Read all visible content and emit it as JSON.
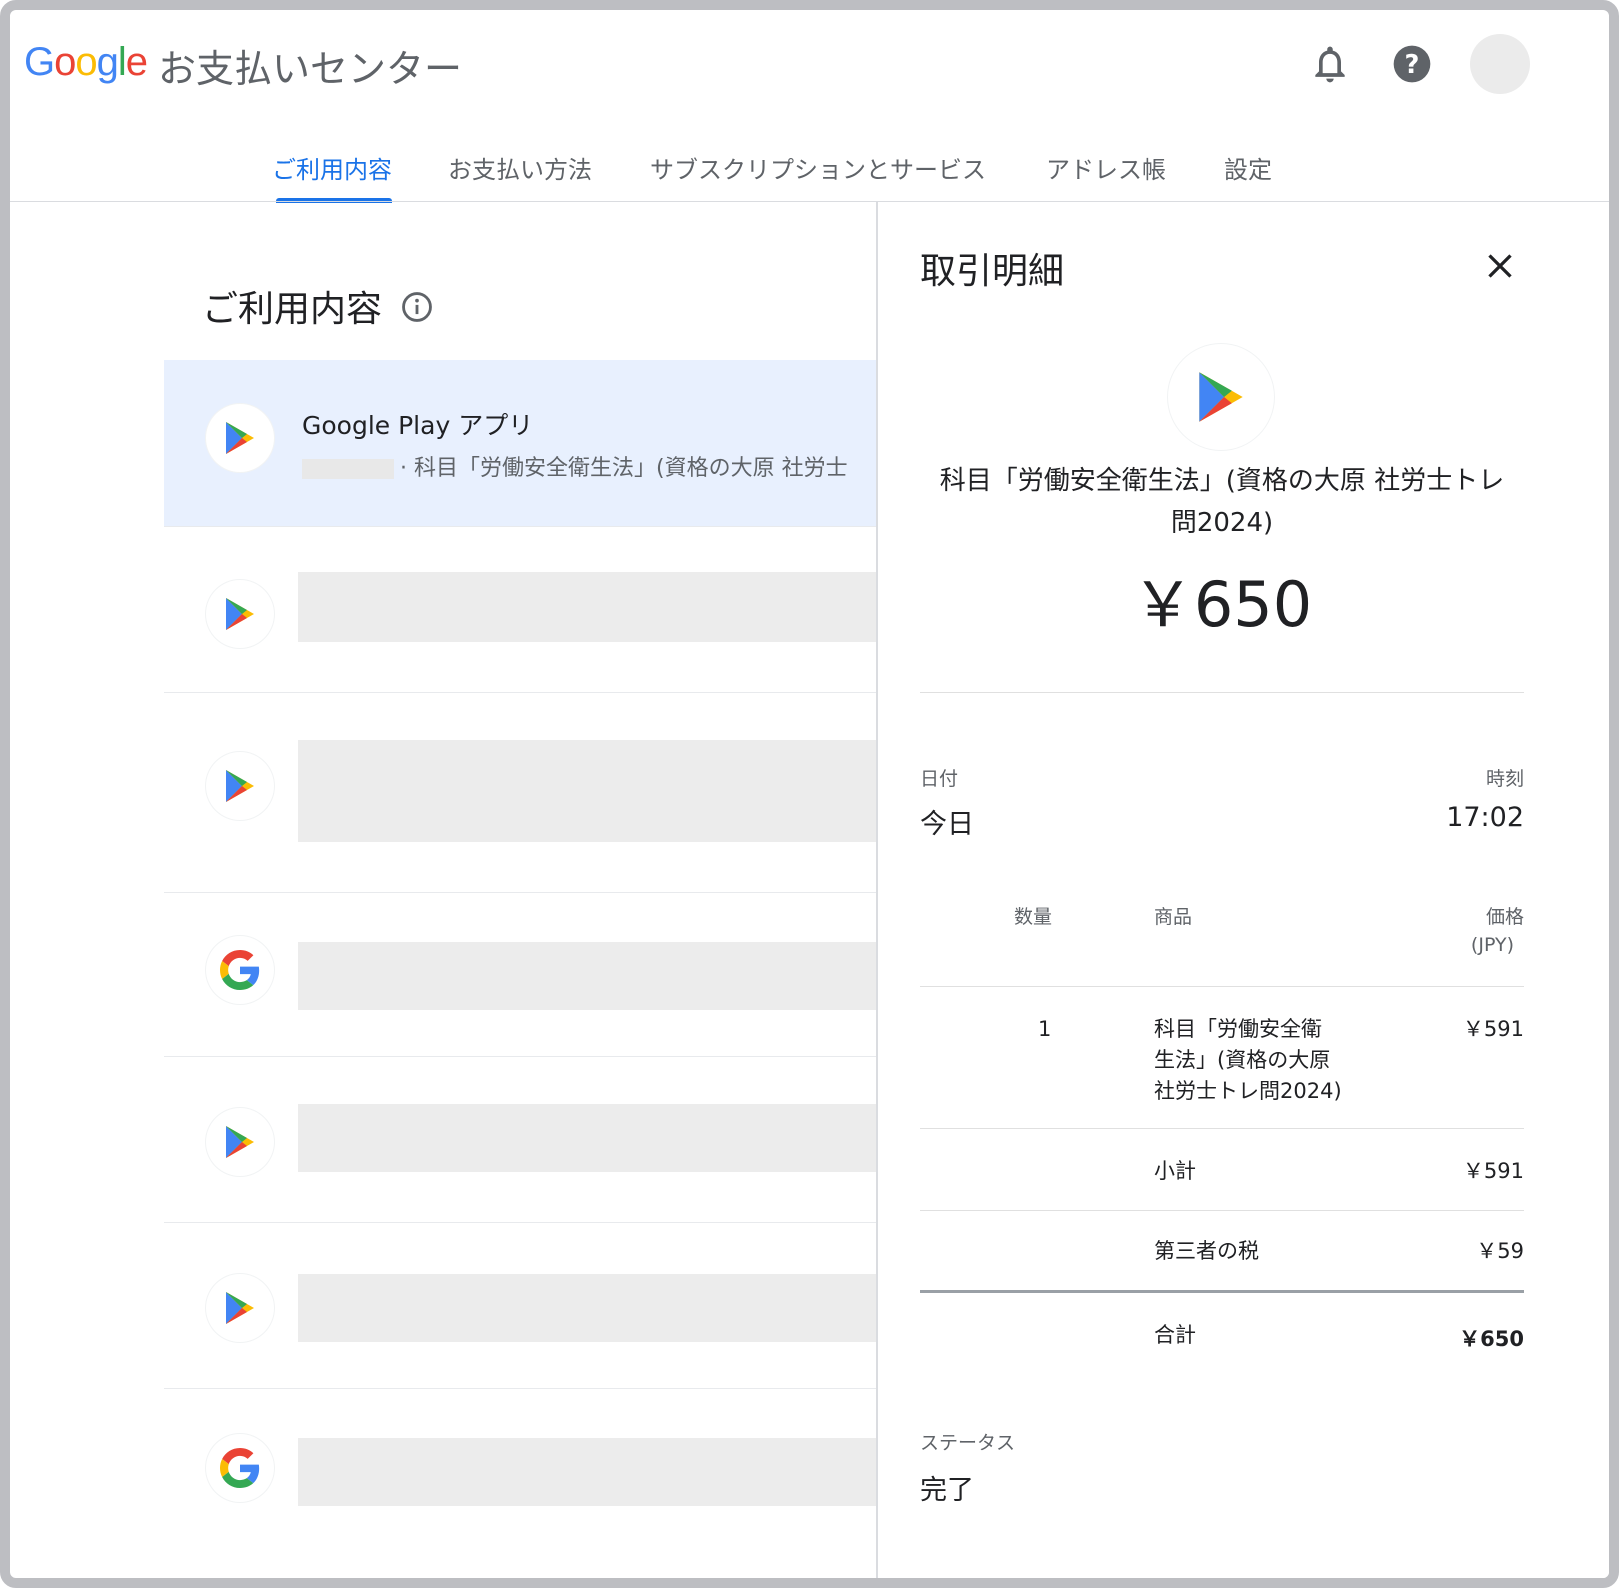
{
  "header": {
    "logo_letters": [
      "G",
      "o",
      "o",
      "g",
      "l",
      "e"
    ],
    "logo_colors": [
      "#4285F4",
      "#EA4335",
      "#FBBC05",
      "#4285F4",
      "#34A853",
      "#EA4335"
    ],
    "app_title": "お支払いセンター",
    "icons": [
      "notifications-bell-icon",
      "help-icon"
    ]
  },
  "tabs": [
    {
      "label": "ご利用内容",
      "active": true
    },
    {
      "label": "お支払い方法",
      "active": false
    },
    {
      "label": "サブスクリプションとサービス",
      "active": false
    },
    {
      "label": "アドレス帳",
      "active": false
    },
    {
      "label": "設定",
      "active": false
    }
  ],
  "activity": {
    "title": "ご利用内容",
    "info_icon": "info-icon",
    "rows": [
      {
        "icon": "google-play-icon",
        "title": "Google Play アプリ",
        "subtitle": "· 科目「労働安全衛生法」(資格の大原 社労士",
        "selected": true
      },
      {
        "icon": "google-play-icon",
        "title": "",
        "subtitle": "",
        "selected": false
      },
      {
        "icon": "google-play-icon",
        "title": "",
        "subtitle": "",
        "selected": false
      },
      {
        "icon": "google-g-icon",
        "title": "",
        "subtitle": "",
        "selected": false
      },
      {
        "icon": "google-play-icon",
        "title": "",
        "subtitle": "",
        "selected": false
      },
      {
        "icon": "google-play-icon",
        "title": "",
        "subtitle": "",
        "selected": false
      },
      {
        "icon": "google-g-icon",
        "title": "",
        "subtitle": "",
        "selected": false
      }
    ]
  },
  "detail": {
    "title": "取引明細",
    "close_icon": "close-icon",
    "item_name_line1": "科目「労働安全衛生法」(資格の大原 社労士トレ",
    "item_name_line2": "問2024)",
    "amount": "￥650",
    "date_label": "日付",
    "date_value": "今日",
    "time_label": "時刻",
    "time_value": "17:02",
    "table": {
      "col_qty": "数量",
      "col_product": "商品",
      "col_price": "価格",
      "col_price_unit": "(JPY)",
      "line": {
        "qty": "1",
        "product_lines": [
          "科目「労働安全衛",
          "生法」(資格の大原",
          "社労士トレ問2024)"
        ],
        "price": "￥591"
      },
      "subtotal_label": "小計",
      "subtotal_value": "￥591",
      "tax_label": "第三者の税",
      "tax_value": "￥59",
      "total_label": "合計",
      "total_value": "￥650"
    },
    "status_label": "ステータス",
    "status_value": "完了"
  }
}
